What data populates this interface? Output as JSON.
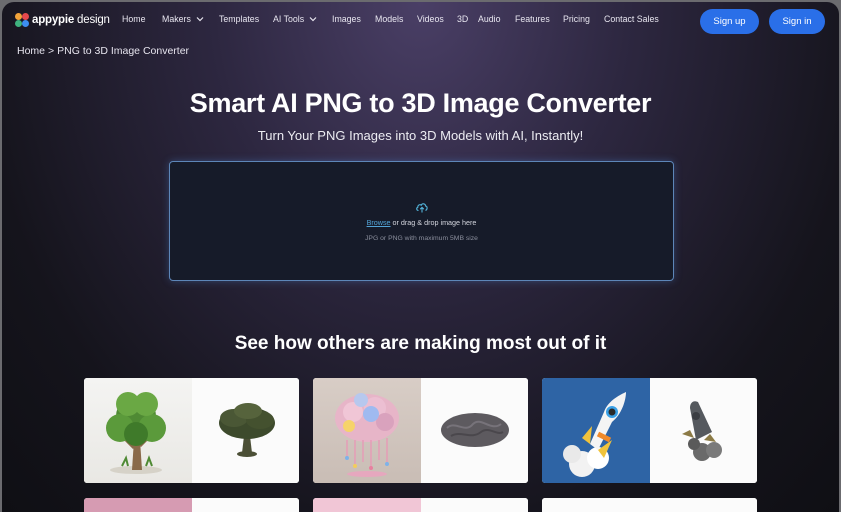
{
  "brand": {
    "name_bold": "appypie",
    "name_light": " design"
  },
  "nav": {
    "items": [
      {
        "label": "Home",
        "dropdown": false
      },
      {
        "label": "Makers",
        "dropdown": true
      },
      {
        "label": "Templates",
        "dropdown": false
      },
      {
        "label": "AI Tools",
        "dropdown": true
      },
      {
        "label": "Images",
        "dropdown": false
      },
      {
        "label": "Models",
        "dropdown": false
      },
      {
        "label": "Videos",
        "dropdown": false
      },
      {
        "label": "3D",
        "dropdown": false
      },
      {
        "label": "Audio",
        "dropdown": false
      },
      {
        "label": "Features",
        "dropdown": false
      },
      {
        "label": "Pricing",
        "dropdown": false
      },
      {
        "label": "Contact Sales",
        "dropdown": false
      }
    ],
    "signup": "Sign up",
    "signin": "Sign in"
  },
  "breadcrumb": {
    "home": "Home",
    "separator": ">",
    "current": "PNG to 3D Image Converter"
  },
  "hero": {
    "title": "Smart AI PNG to 3D Image Converter",
    "subtitle": "Turn Your PNG Images into 3D Models with AI, Instantly!"
  },
  "upload": {
    "browse": "Browse",
    "instruction": " or drag & drop image here",
    "hint": "JPG or PNG with maximum 5MB size"
  },
  "examples": {
    "title": "See how others are making most out of it",
    "cards": [
      {
        "name": "tree",
        "before": "tree-image",
        "after": "tree-3d-model"
      },
      {
        "name": "brain",
        "before": "brain-image",
        "after": "brain-3d-model"
      },
      {
        "name": "rocket",
        "before": "rocket-image",
        "after": "rocket-3d-model"
      }
    ]
  },
  "colors": {
    "accent": "#2a6fe8",
    "link": "#52a3d6",
    "dropzone_border": "#5d86b8"
  }
}
